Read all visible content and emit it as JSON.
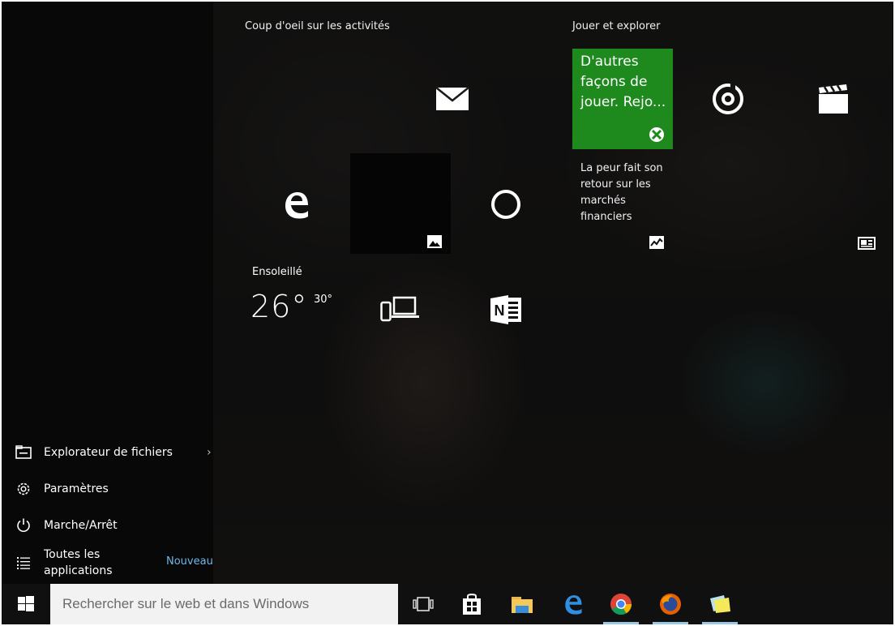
{
  "groups": {
    "activities_title": "Coup d'oeil sur les activités",
    "play_title": "Jouer et explorer"
  },
  "tiles": {
    "mail_icon": "mail-icon",
    "edge_icon": "edge-icon",
    "photos_icon": "photos-icon",
    "cortana_icon": "cortana-icon",
    "weather": {
      "label": "Ensoleillé",
      "temperature": "26°",
      "high": "30°"
    },
    "phone_companion_icon": "phone-companion-icon",
    "onenote_icon": "onenote-icon",
    "xbox": {
      "text": "D'autres façons de jouer. Rejo...",
      "color": "#1e8a1e",
      "icon": "xbox-icon"
    },
    "groove_icon": "groove-music-icon",
    "movies_icon": "movies-tv-icon",
    "money": {
      "text": "La peur fait son retour sur les marchés financiers",
      "icon": "money-chart-icon"
    },
    "news_icon": "news-icon"
  },
  "left_menu": {
    "file_explorer": "Explorateur de fichiers",
    "settings": "Paramètres",
    "power": "Marche/Arrêt",
    "all_apps": "Toutes les applications",
    "new_badge": "Nouveau"
  },
  "taskbar": {
    "search_placeholder": "Rechercher sur le web et dans Windows",
    "accent_color": "#9bc7e6",
    "icons": [
      "task-view-icon",
      "store-icon",
      "file-explorer-icon",
      "edge-icon",
      "chrome-icon",
      "firefox-icon",
      "sticky-notes-icon"
    ]
  }
}
